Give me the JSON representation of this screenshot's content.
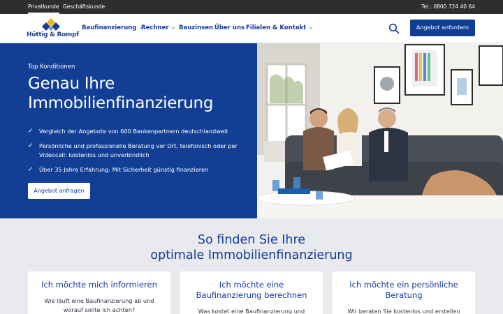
{
  "topbar": {
    "tabs": [
      {
        "label": "Privatkunde",
        "active": true
      },
      {
        "label": "Geschäftskunde",
        "active": false
      }
    ],
    "phone": "Tel.: 0800 724 40 64"
  },
  "header": {
    "logo_text": "Hüttig & Rompf",
    "nav": [
      {
        "label": "Baufinanzierung",
        "has_dropdown": true
      },
      {
        "label": "Rechner",
        "has_dropdown": true
      },
      {
        "label": "Bauzinsen",
        "has_dropdown": false
      },
      {
        "label": "Über uns",
        "has_dropdown": false
      },
      {
        "label": "Filialen & Kontakt",
        "has_dropdown": true
      }
    ],
    "search_icon": "search-icon",
    "cta_label": "Angebot anfordern"
  },
  "hero": {
    "kicker": "Top Konditionen",
    "title": "Genau Ihre Immobilienfinanzierung",
    "bullets": [
      "Vergleich der Angebote von 600 Bankenpartnern deutschlandweit",
      "Persönliche und professionelle Beratung vor Ort, telefonisch oder per Videocall: kostenlos und unverbindlich",
      "Über 35 Jahre Erfahrung: Mit Sicherheit günstig finanzieren"
    ],
    "cta_label": "Angebot anfragen"
  },
  "section": {
    "title_line1": "So finden Sie Ihre",
    "title_line2": "optimale Immobilienfinanzierung",
    "cards": [
      {
        "title": "Ich möchte mich informieren",
        "text": "Wie läuft eine Baufinanzierung ab und worauf sollte ich achten?"
      },
      {
        "title": "Ich möchte eine Baufinanzierung berechnen",
        "text": "Was kostet eine Baufinanzierung und was"
      },
      {
        "title": "Ich möchte ein persönliche Beratung",
        "text": "Wir beraten Sie kostenlos und erstellen eine"
      }
    ]
  },
  "colors": {
    "brand_blue": "#123f95",
    "topbar": "#2e2e2e",
    "section_bg": "#e8eaee"
  }
}
